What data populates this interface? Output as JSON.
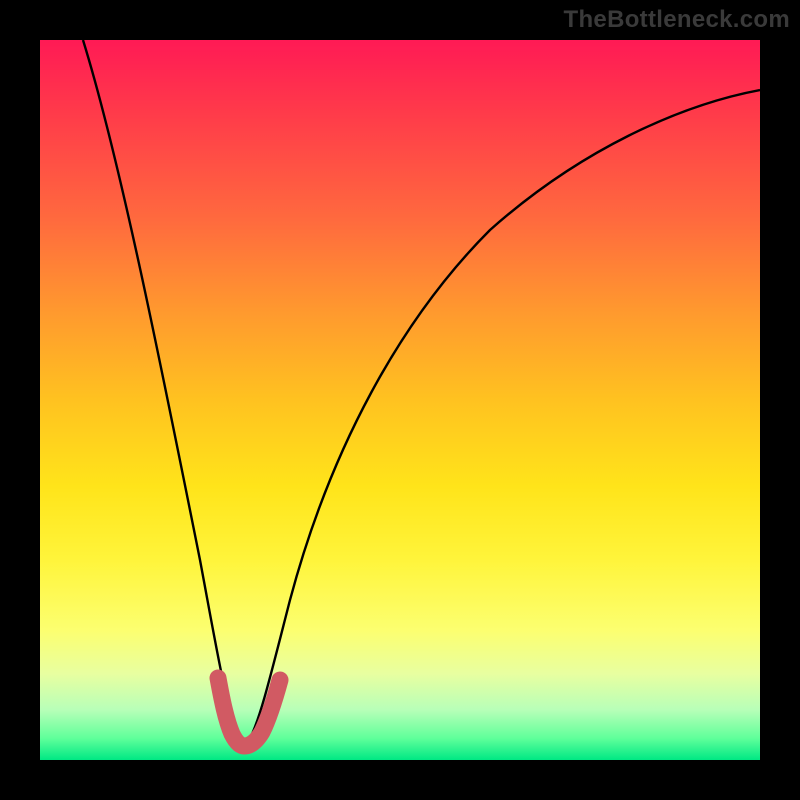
{
  "watermark": {
    "text": "TheBottleneck.com"
  },
  "chart_data": {
    "type": "line",
    "title": "",
    "xlabel": "",
    "ylabel": "",
    "xlim": [
      0,
      100
    ],
    "ylim": [
      0,
      100
    ],
    "grid": false,
    "legend": false,
    "series": [
      {
        "name": "bottleneck-curve",
        "color": "#000000",
        "x": [
          6,
          10,
          14,
          18,
          22,
          24,
          26,
          27,
          28,
          29,
          30,
          32,
          34,
          38,
          44,
          52,
          62,
          74,
          88,
          100
        ],
        "y": [
          100,
          82,
          62,
          42,
          22,
          12,
          6,
          4,
          3,
          4,
          6,
          12,
          22,
          38,
          52,
          64,
          74,
          82,
          88,
          92
        ]
      },
      {
        "name": "minimum-highlight",
        "color": "#d15a63",
        "x": [
          24,
          25,
          26,
          27,
          28,
          29,
          30,
          31,
          32,
          33
        ],
        "y": [
          12,
          8,
          6,
          4,
          3,
          4,
          6,
          8,
          10,
          12
        ]
      }
    ]
  }
}
